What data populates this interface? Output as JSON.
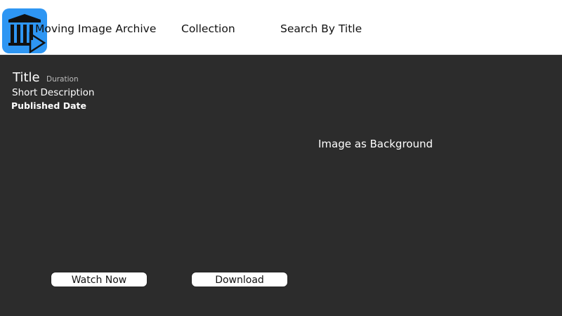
{
  "header": {
    "logo_icon": "archive-building-play-icon",
    "logo_color": "#2e96f3",
    "nav": [
      {
        "label": "Moving Image Archive"
      },
      {
        "label": "Collection"
      },
      {
        "label": "Search By Title"
      }
    ]
  },
  "detail": {
    "title": "Title",
    "duration": "Duration",
    "description": "Short Description",
    "published_date": "Published Date"
  },
  "background": {
    "label": "Image as Background"
  },
  "actions": {
    "watch_label": "Watch Now",
    "download_label": "Download"
  }
}
